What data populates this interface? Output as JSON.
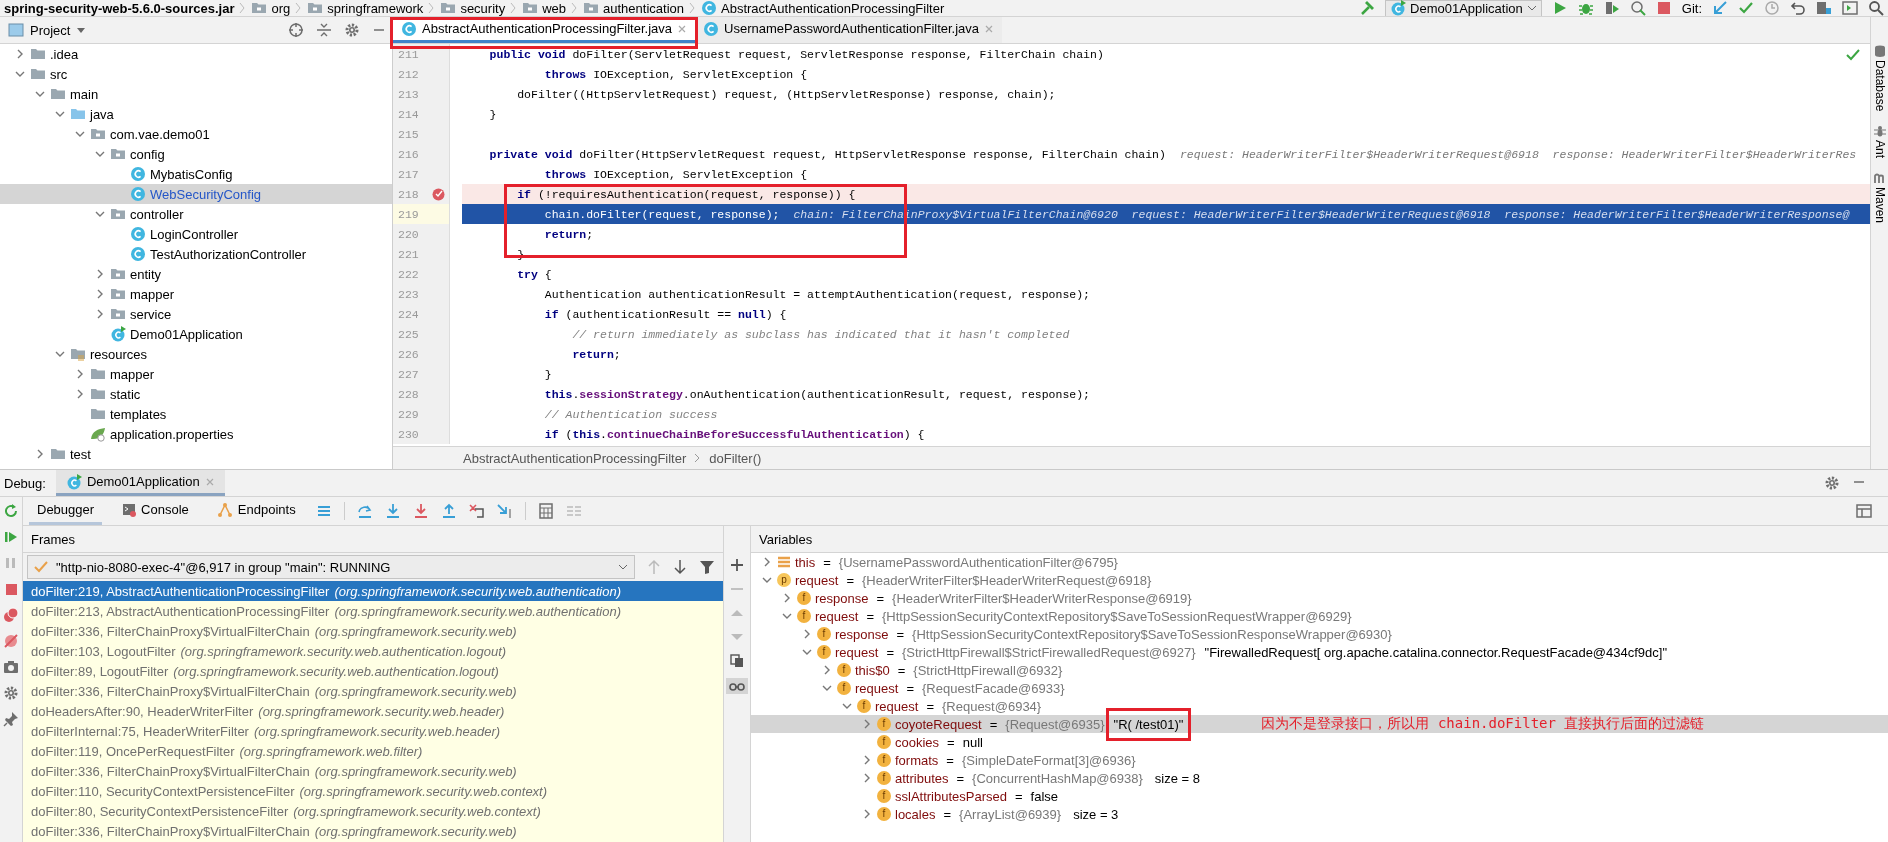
{
  "breadcrumb": [
    {
      "text": "spring-security-web-5.6.0-sources.jar",
      "kind": "jar"
    },
    {
      "text": "org",
      "kind": "package"
    },
    {
      "text": "springframework",
      "kind": "package"
    },
    {
      "text": "security",
      "kind": "package"
    },
    {
      "text": "web",
      "kind": "package"
    },
    {
      "text": "authentication",
      "kind": "package"
    },
    {
      "text": "AbstractAuthenticationProcessingFilter",
      "kind": "class"
    }
  ],
  "toolbar": {
    "run_config": "Demo01Application",
    "git_label": "Git:"
  },
  "project": {
    "title": "Project",
    "tree": [
      {
        "label": ".idea",
        "kind": "folder",
        "expanded": false,
        "selected": false,
        "modified": false
      },
      {
        "label": "src",
        "kind": "folder",
        "expanded": true,
        "selected": false,
        "modified": false,
        "children": [
          {
            "label": "main",
            "kind": "folder",
            "expanded": true,
            "selected": false,
            "modified": false,
            "children": [
              {
                "label": "java",
                "kind": "source",
                "expanded": true,
                "selected": false,
                "modified": false,
                "children": [
                  {
                    "label": "com.vae.demo01",
                    "kind": "package",
                    "expanded": true,
                    "selected": false,
                    "modified": false,
                    "children": [
                      {
                        "label": "config",
                        "kind": "package",
                        "expanded": true,
                        "selected": false,
                        "modified": false,
                        "children": [
                          {
                            "label": "MybatisConfig",
                            "kind": "class",
                            "selected": false,
                            "modified": false
                          },
                          {
                            "label": "WebSecurityConfig",
                            "kind": "class",
                            "selected": true,
                            "modified": true
                          }
                        ]
                      },
                      {
                        "label": "controller",
                        "kind": "package",
                        "expanded": true,
                        "selected": false,
                        "modified": false,
                        "children": [
                          {
                            "label": "LoginController",
                            "kind": "class",
                            "selected": false,
                            "modified": false
                          },
                          {
                            "label": "TestAuthorizationController",
                            "kind": "class",
                            "selected": false,
                            "modified": false
                          }
                        ]
                      },
                      {
                        "label": "entity",
                        "kind": "package",
                        "expanded": false,
                        "selected": false,
                        "modified": false
                      },
                      {
                        "label": "mapper",
                        "kind": "package",
                        "expanded": false,
                        "selected": false,
                        "modified": false
                      },
                      {
                        "label": "service",
                        "kind": "package",
                        "expanded": false,
                        "selected": false,
                        "modified": false
                      },
                      {
                        "label": "Demo01Application",
                        "kind": "application",
                        "selected": false,
                        "modified": false
                      }
                    ]
                  }
                ]
              },
              {
                "label": "resources",
                "kind": "resources",
                "expanded": true,
                "selected": false,
                "modified": false,
                "children": [
                  {
                    "label": "mapper",
                    "kind": "folder",
                    "expanded": false,
                    "selected": false,
                    "modified": false
                  },
                  {
                    "label": "static",
                    "kind": "folder",
                    "expanded": false,
                    "selected": false,
                    "modified": false
                  },
                  {
                    "label": "templates",
                    "kind": "folder",
                    "selected": false,
                    "modified": false
                  },
                  {
                    "label": "application.properties",
                    "kind": "properties",
                    "selected": false,
                    "modified": false
                  }
                ]
              }
            ]
          },
          {
            "label": "test",
            "kind": "folder",
            "expanded": false,
            "selected": false,
            "modified": false
          }
        ]
      }
    ]
  },
  "editor": {
    "tabs": [
      {
        "label": "AbstractAuthenticationProcessingFilter.java",
        "selected": true
      },
      {
        "label": "UsernamePasswordAuthenticationFilter.java",
        "selected": false
      }
    ],
    "lines": [
      {
        "number": "211",
        "kind": "normal",
        "code": [
          {
            "text": "    public void",
            "kind": "kw"
          },
          {
            "text": " doFilter(ServletRequest request, ServletResponse response, FilterChain chain)",
            "kind": "plain"
          }
        ]
      },
      {
        "number": "212",
        "kind": "normal",
        "code": [
          {
            "text": "            throws",
            "kind": "kw"
          },
          {
            "text": " IOException, ServletException {",
            "kind": "plain"
          }
        ]
      },
      {
        "number": "213",
        "kind": "normal",
        "code": [
          {
            "text": "        doFilter((HttpServletRequest) request, (HttpServletResponse) response, chain);",
            "kind": "plain"
          }
        ]
      },
      {
        "number": "214",
        "kind": "normal",
        "code": [
          {
            "text": "    }",
            "kind": "plain"
          }
        ]
      },
      {
        "number": "215",
        "kind": "normal"
      },
      {
        "number": "216",
        "kind": "normal",
        "code": [
          {
            "text": "    private void",
            "kind": "kw"
          },
          {
            "text": " doFilter(HttpServletRequest request, HttpServletResponse response, FilterChain chain)",
            "kind": "plain"
          }
        ],
        "hint": "request: HeaderWriterFilter$HeaderWriterRequest@6918  response: HeaderWriterFilter$HeaderWriterRes"
      },
      {
        "number": "217",
        "kind": "normal",
        "code": [
          {
            "text": "            throws",
            "kind": "kw"
          },
          {
            "text": " IOException, ServletException {",
            "kind": "plain"
          }
        ]
      },
      {
        "number": "218",
        "kind": "breakpoint",
        "code": [
          {
            "text": "        if",
            "kind": "kw"
          },
          {
            "text": " (!requiresAuthentication(request, response)) {",
            "kind": "plain"
          }
        ]
      },
      {
        "number": "219",
        "kind": "execution",
        "code": [
          {
            "text": "            chain.doFilter(request, response);",
            "kind": "plain"
          }
        ],
        "hint": "chain: FilterChainProxy$VirtualFilterChain@6920  request: HeaderWriterFilter$HeaderWriterRequest@6918  response: HeaderWriterFilter$HeaderWriterResponse@"
      },
      {
        "number": "220",
        "kind": "normal",
        "code": [
          {
            "text": "            return",
            "kind": "kw"
          },
          {
            "text": ";",
            "kind": "plain"
          }
        ]
      },
      {
        "number": "221",
        "kind": "normal",
        "code": [
          {
            "text": "        }",
            "kind": "plain"
          }
        ]
      },
      {
        "number": "222",
        "kind": "normal",
        "code": [
          {
            "text": "        try",
            "kind": "kw"
          },
          {
            "text": " {",
            "kind": "plain"
          }
        ]
      },
      {
        "number": "223",
        "kind": "normal",
        "code": [
          {
            "text": "            Authentication authenticationResult = attemptAuthentication(request, response);",
            "kind": "plain"
          }
        ]
      },
      {
        "number": "224",
        "kind": "normal",
        "code": [
          {
            "text": "            if",
            "kind": "kw"
          },
          {
            "text": " (authenticationResult == ",
            "kind": "plain"
          },
          {
            "text": "null",
            "kind": "kw"
          },
          {
            "text": ") {",
            "kind": "plain"
          }
        ]
      },
      {
        "number": "225",
        "kind": "normal",
        "code": [
          {
            "text": "                // return immediately as subclass has indicated that it hasn't completed",
            "kind": "comment"
          }
        ]
      },
      {
        "number": "226",
        "kind": "normal",
        "code": [
          {
            "text": "                return",
            "kind": "kw"
          },
          {
            "text": ";",
            "kind": "plain"
          }
        ]
      },
      {
        "number": "227",
        "kind": "normal",
        "code": [
          {
            "text": "            }",
            "kind": "plain"
          }
        ]
      },
      {
        "number": "228",
        "kind": "normal",
        "code": [
          {
            "text": "            this",
            "kind": "kw"
          },
          {
            "text": ".",
            "kind": "plain"
          },
          {
            "text": "sessionStrategy",
            "kind": "field"
          },
          {
            "text": ".onAuthentication(authenticationResult, request, response);",
            "kind": "plain"
          }
        ]
      },
      {
        "number": "229",
        "kind": "normal",
        "code": [
          {
            "text": "            // Authentication success",
            "kind": "comment"
          }
        ]
      },
      {
        "number": "230",
        "kind": "normal",
        "code": [
          {
            "text": "            if",
            "kind": "kw"
          },
          {
            "text": " (",
            "kind": "plain"
          },
          {
            "text": "this",
            "kind": "kw"
          },
          {
            "text": ".",
            "kind": "plain"
          },
          {
            "text": "continueChainBeforeSuccessfulAuthentication",
            "kind": "field"
          },
          {
            "text": ") {",
            "kind": "plain"
          }
        ]
      }
    ],
    "breadcrumb": [
      "AbstractAuthenticationProcessingFilter",
      "doFilter()"
    ]
  },
  "side_tools": [
    {
      "label": "Database",
      "kind": "database"
    },
    {
      "label": "Ant",
      "kind": "ant"
    },
    {
      "label": "Maven",
      "kind": "maven"
    }
  ],
  "debug": {
    "label": "Debug:",
    "session": "Demo01Application",
    "tabs": [
      {
        "label": "Debugger",
        "kind": "debugger",
        "selected": true
      },
      {
        "label": "Console",
        "kind": "console",
        "selected": false
      },
      {
        "label": "Endpoints",
        "kind": "endpoints",
        "selected": false
      }
    ],
    "frames": {
      "title": "Frames",
      "thread": "\"http-nio-8080-exec-4\"@6,917 in group \"main\": RUNNING",
      "items": [
        {
          "method": "doFilter:219, AbstractAuthenticationProcessingFilter",
          "package": "(org.springframework.security.web.authentication)",
          "selected": true
        },
        {
          "method": "doFilter:213, AbstractAuthenticationProcessingFilter",
          "package": "(org.springframework.security.web.authentication)",
          "selected": false
        },
        {
          "method": "doFilter:336, FilterChainProxy$VirtualFilterChain",
          "package": "(org.springframework.security.web)",
          "selected": false
        },
        {
          "method": "doFilter:103, LogoutFilter",
          "package": "(org.springframework.security.web.authentication.logout)",
          "selected": false
        },
        {
          "method": "doFilter:89, LogoutFilter",
          "package": "(org.springframework.security.web.authentication.logout)",
          "selected": false
        },
        {
          "method": "doFilter:336, FilterChainProxy$VirtualFilterChain",
          "package": "(org.springframework.security.web)",
          "selected": false
        },
        {
          "method": "doHeadersAfter:90, HeaderWriterFilter",
          "package": "(org.springframework.security.web.header)",
          "selected": false
        },
        {
          "method": "doFilterInternal:75, HeaderWriterFilter",
          "package": "(org.springframework.security.web.header)",
          "selected": false
        },
        {
          "method": "doFilter:119, OncePerRequestFilter",
          "package": "(org.springframework.web.filter)",
          "selected": false
        },
        {
          "method": "doFilter:336, FilterChainProxy$VirtualFilterChain",
          "package": "(org.springframework.security.web)",
          "selected": false
        },
        {
          "method": "doFilter:110, SecurityContextPersistenceFilter",
          "package": "(org.springframework.security.web.context)",
          "selected": false
        },
        {
          "method": "doFilter:80, SecurityContextPersistenceFilter",
          "package": "(org.springframework.security.web.context)",
          "selected": false
        },
        {
          "method": "doFilter:336, FilterChainProxy$VirtualFilterChain",
          "package": "(org.springframework.security.web)",
          "selected": false
        }
      ]
    },
    "variables": {
      "title": "Variables",
      "tree": [
        {
          "kind": "this",
          "name": "this",
          "operator": "=",
          "type": "{UsernamePasswordAuthenticationFilter@6795}",
          "expanded": false,
          "selected": false
        },
        {
          "kind": "parameter",
          "badge": "p",
          "name": "request",
          "operator": "=",
          "type": "{HeaderWriterFilter$HeaderWriterRequest@6918}",
          "expanded": true,
          "selected": false,
          "children": [
            {
              "kind": "field",
              "badge": "f",
              "name": "response",
              "operator": "=",
              "type": "{HeaderWriterFilter$HeaderWriterResponse@6919}",
              "expanded": false,
              "selected": false
            },
            {
              "kind": "field",
              "badge": "f",
              "name": "request",
              "operator": "=",
              "type": "{HttpSessionSecurityContextRepository$SaveToSessionRequestWrapper@6929}",
              "expanded": true,
              "selected": false,
              "children": [
                {
                  "kind": "field",
                  "badge": "f",
                  "name": "response",
                  "operator": "=",
                  "type": "{HttpSessionSecurityContextRepository$SaveToSessionResponseWrapper@6930}",
                  "expanded": false,
                  "selected": false
                },
                {
                  "kind": "field",
                  "badge": "f",
                  "name": "request",
                  "operator": "=",
                  "type": "{StrictHttpFirewall$StrictFirewalledRequest@6927}",
                  "value": "\"FirewalledRequest[ org.apache.catalina.connector.RequestFacade@434cf9dc]\"",
                  "expanded": true,
                  "selected": false,
                  "children": [
                    {
                      "kind": "field",
                      "badge": "f",
                      "name": "this$0",
                      "operator": "=",
                      "type": "{StrictHttpFirewall@6932}",
                      "expanded": false,
                      "selected": false
                    },
                    {
                      "kind": "field",
                      "badge": "f",
                      "name": "request",
                      "operator": "=",
                      "type": "{RequestFacade@6933}",
                      "expanded": true,
                      "selected": false,
                      "children": [
                        {
                          "kind": "field",
                          "badge": "f",
                          "name": "request",
                          "operator": "=",
                          "type": "{Request@6934}",
                          "expanded": true,
                          "selected": false,
                          "children": [
                            {
                              "kind": "field",
                              "badge": "f",
                              "name": "coyoteRequest",
                              "operator": "=",
                              "type": "{Request@6935}",
                              "value": "\"R( /test01)\"",
                              "expanded": false,
                              "selected": true
                            },
                            {
                              "kind": "field",
                              "badge": "f",
                              "name": "cookies",
                              "operator": "=",
                              "value": "null",
                              "selected": false
                            },
                            {
                              "kind": "field",
                              "badge": "f",
                              "name": "formats",
                              "operator": "=",
                              "type": "{SimpleDateFormat[3]@6936}",
                              "expanded": false,
                              "selected": false
                            },
                            {
                              "kind": "field",
                              "badge": "f",
                              "name": "attributes",
                              "operator": "=",
                              "type": "{ConcurrentHashMap@6938}",
                              "extra": "size = 8",
                              "expanded": false,
                              "selected": false
                            },
                            {
                              "kind": "field",
                              "badge": "f",
                              "name": "sslAttributesParsed",
                              "operator": "=",
                              "value": "false",
                              "selected": false
                            },
                            {
                              "kind": "field",
                              "badge": "f",
                              "name": "locales",
                              "operator": "=",
                              "type": "{ArrayList@6939}",
                              "extra": "size = 3",
                              "expanded": false,
                              "selected": false
                            }
                          ]
                        }
                      ]
                    }
                  ]
                }
              ]
            }
          ]
        }
      ]
    }
  },
  "annotations": [
    {
      "kind": "tab-frame"
    },
    {
      "kind": "code-frame"
    },
    {
      "kind": "value-frame"
    },
    {
      "kind": "note",
      "text": "因为不是登录接口，所以用 chain.doFilter 直接执行后面的过滤链"
    }
  ]
}
